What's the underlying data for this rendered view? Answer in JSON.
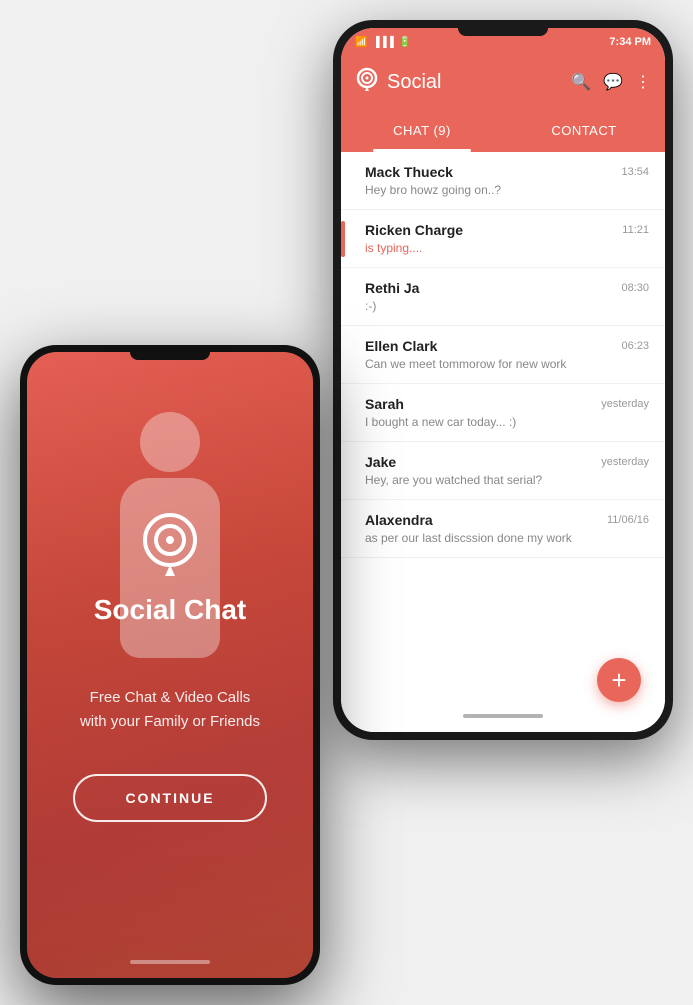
{
  "back_phone": {
    "status_bar": {
      "wifi": "📶",
      "signal": "📶",
      "battery": "🔋",
      "time": "7:34 PM"
    },
    "header": {
      "logo_label": "Q",
      "title": "Social",
      "search_icon": "🔍",
      "compose_icon": "✉",
      "menu_icon": "⋮"
    },
    "tabs": [
      {
        "label": "CHAT (9)",
        "active": true
      },
      {
        "label": "CONTACT",
        "active": false
      }
    ],
    "chat_list": [
      {
        "name": "Mack Thueck",
        "time": "13:54",
        "preview": "Hey bro howz going on..?",
        "typing": false,
        "has_indicator": false
      },
      {
        "name": "Ricken Charge",
        "time": "11:21",
        "preview": "is typing....",
        "typing": true,
        "has_indicator": true
      },
      {
        "name": "Rethi Ja",
        "time": "08:30",
        "preview": ":-)",
        "typing": false,
        "has_indicator": false
      },
      {
        "name": "Ellen Clark",
        "time": "06:23",
        "preview": "Can we meet tommorow for new work",
        "typing": false,
        "has_indicator": false
      },
      {
        "name": "Sarah",
        "time": "yesterday",
        "preview": "I bought a new car today... :)",
        "typing": false,
        "has_indicator": false
      },
      {
        "name": "Jake",
        "time": "yesterday",
        "preview": "Hey, are you watched that serial?",
        "typing": false,
        "has_indicator": false
      },
      {
        "name": "Alaxendra",
        "time": "11/06/16",
        "preview": "as per our last discssion done my work",
        "typing": false,
        "has_indicator": false
      }
    ],
    "fab_label": "+"
  },
  "front_phone": {
    "logo_alt": "Social Chat Logo",
    "title": "Social Chat",
    "subtitle_line1": "Free Chat & Video Calls",
    "subtitle_line2": "with your Family or Friends",
    "continue_label": "CONTINUE"
  }
}
